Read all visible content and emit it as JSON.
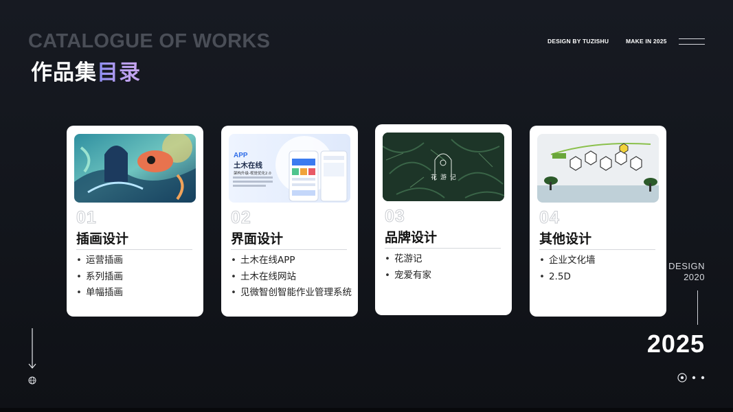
{
  "header": {
    "title_en": "CATALOGUE OF WORKS",
    "title_cn_main": "作品集",
    "title_cn_accent": "目录",
    "design_by": "DESIGN BY TUZISHU",
    "make_in": "MAKE IN 2025"
  },
  "cards": [
    {
      "num": "01",
      "title": "插画设计",
      "items": [
        "运营插画",
        "系列插画",
        "单幅插画"
      ]
    },
    {
      "num": "02",
      "title": "界面设计",
      "items": [
        "土木在线APP",
        "土木在线网站",
        "见微智创智能作业管理系统"
      ],
      "thumb": {
        "app": "APP",
        "name": "土木在线",
        "tagline": "架构升级-视觉优化2.0"
      }
    },
    {
      "num": "03",
      "title": "品牌设计",
      "items": [
        "花游记",
        "宠爱有家"
      ],
      "thumb": {
        "logo_text": "花 游 记"
      }
    },
    {
      "num": "04",
      "title": "其他设计",
      "items": [
        "企业文化墙",
        "2.5D"
      ]
    }
  ],
  "side": {
    "design_label": "DESIGN",
    "design_year": "2020",
    "big_year": "2025"
  },
  "icons": [
    "hamburger-icon",
    "arrow-down-icon",
    "globe-icon",
    "pagination-dots"
  ],
  "colors": {
    "accent_start": "#8a8cf2",
    "accent_end": "#c9a6ef",
    "background": "#15181f"
  }
}
